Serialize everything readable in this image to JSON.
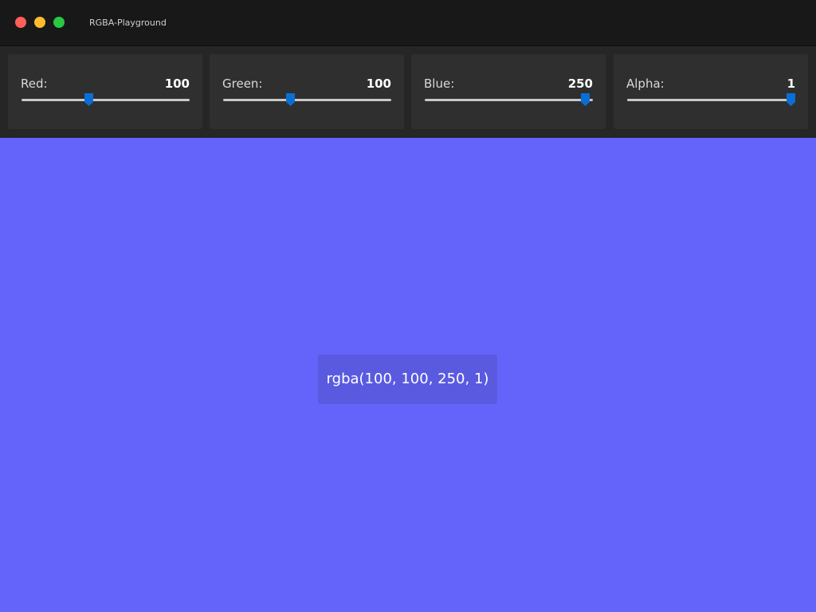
{
  "window": {
    "title": "RGBA-Playground"
  },
  "colors": {
    "titlebar_bg": "#181818",
    "controls_bg": "#262626",
    "card_bg": "#2f2f2f",
    "slider_track": "#c8c8c8",
    "slider_thumb": "#0a6fd4",
    "traffic_close": "#ff5f57",
    "traffic_minimize": "#febc2e",
    "traffic_zoom": "#28c840",
    "readout_bg": "#5a5ae0"
  },
  "controls": {
    "red": {
      "label": "Red:",
      "value": "100",
      "min": 0,
      "max": 255
    },
    "green": {
      "label": "Green:",
      "value": "100",
      "min": 0,
      "max": 255
    },
    "blue": {
      "label": "Blue:",
      "value": "250",
      "min": 0,
      "max": 255
    },
    "alpha": {
      "label": "Alpha:",
      "value": "1",
      "min": 0,
      "max": 1
    }
  },
  "preview": {
    "color_text": "rgba(100, 100, 250, 1)"
  }
}
